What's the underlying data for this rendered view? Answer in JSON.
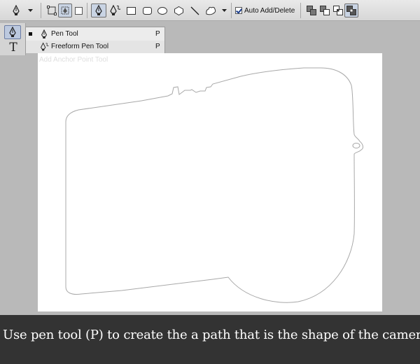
{
  "options_bar": {
    "auto_add_delete_label": "Auto Add/Delete",
    "auto_add_delete_checked": true
  },
  "flyout": {
    "items": [
      {
        "label": "Pen Tool",
        "shortcut": "P",
        "selected": true
      },
      {
        "label": "Freeform Pen Tool",
        "shortcut": "P",
        "selected": false
      }
    ],
    "ghost_label": "Add Anchor Point Tool"
  },
  "caption": {
    "text": "Use pen tool (P) to create the a path that is the shape of the camera"
  },
  "colors": {
    "workspace": "#b9b9b9",
    "canvas": "#ffffff",
    "caption_bar": "#333333",
    "caption_text": "#ffffff",
    "path_stroke": "#a8a8a8"
  }
}
